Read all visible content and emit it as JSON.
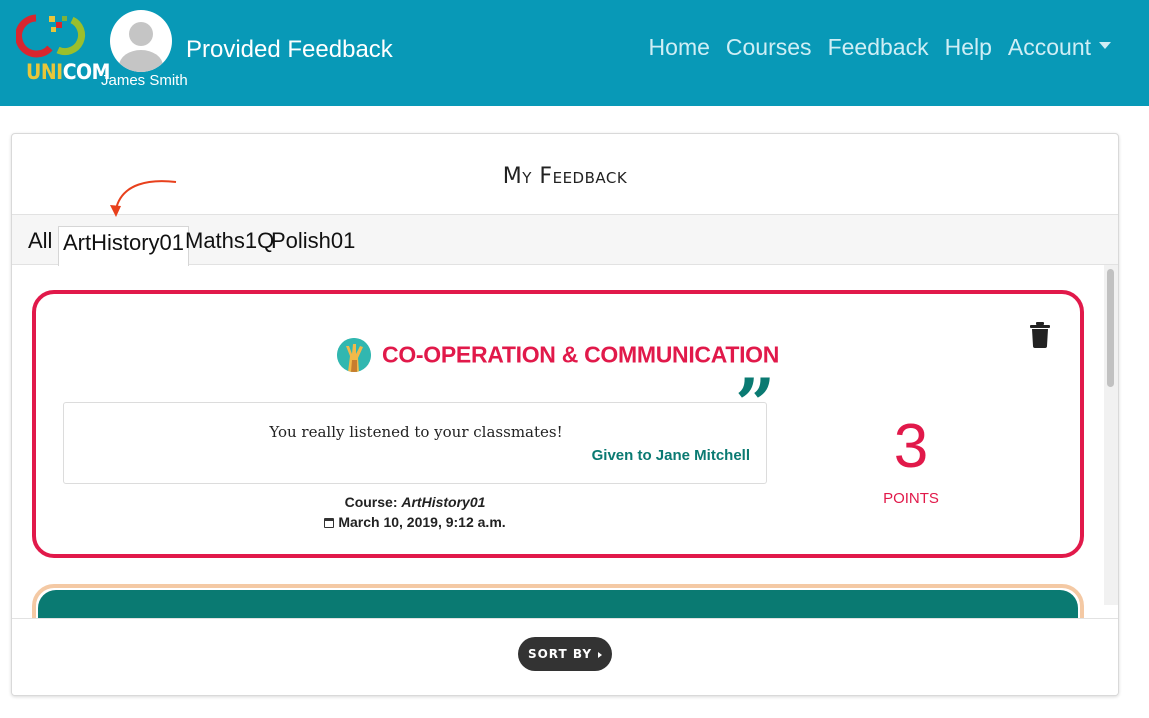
{
  "header": {
    "logo_text_1": "UNI",
    "logo_text_2": "COM",
    "user_name": "James Smith",
    "page_title": "Provided Feedback",
    "nav": [
      {
        "label": "Home"
      },
      {
        "label": "Courses"
      },
      {
        "label": "Feedback"
      },
      {
        "label": "Help"
      },
      {
        "label": "Account"
      }
    ],
    "colors": {
      "navbar": "#0899b7",
      "nav_text": "#cfeef5"
    }
  },
  "main": {
    "title": "My Feedback",
    "tabs": [
      {
        "label": "All",
        "active": false
      },
      {
        "label": "ArtHistory01",
        "active": true
      },
      {
        "label": "Maths1Q",
        "active": false
      },
      {
        "label": "Polish01",
        "active": false
      }
    ],
    "feedback_items": [
      {
        "category": "CO-OPERATION & COMMUNICATION",
        "category_icon": "hands-raised-icon",
        "comment": "You really listened to your classmates!",
        "given_to": "Given to Jane Mitchell",
        "course_label": "Course:",
        "course_name": "ArtHistory01",
        "date": "March 10, 2019, 9:12 a.m.",
        "points": "3",
        "points_label": "POINTS",
        "accent_color": "#e1194a",
        "quote_color": "#0a7a72"
      }
    ],
    "sort_button_label": "SORT BY"
  }
}
